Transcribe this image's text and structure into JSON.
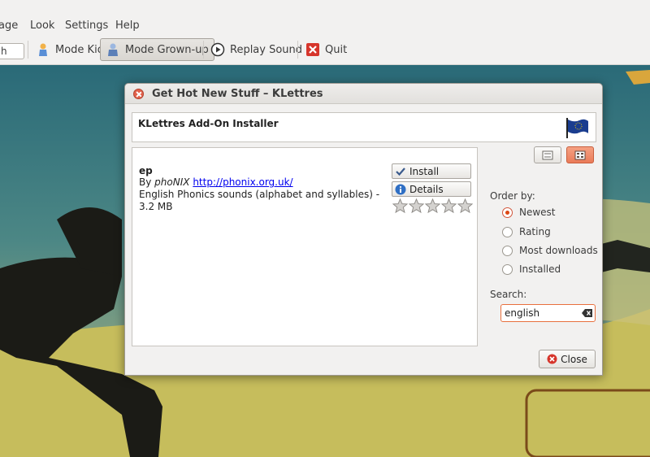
{
  "menubar": {
    "items": [
      "age",
      "Look",
      "Settings",
      "Help"
    ]
  },
  "toolbar": {
    "combo_value": "h",
    "mode_kid": "Mode Kid",
    "mode_grownup": "Mode Grown-up",
    "replay": "Replay Sound",
    "quit": "Quit"
  },
  "dialog": {
    "title": "Get Hot New Stuff – KLettres",
    "header": "KLettres Add-On Installer",
    "item": {
      "name": "ep",
      "by": "By",
      "author": "phoNIX",
      "url": "http://phonix.org.uk/",
      "description": "English Phonics sounds (alphabet and syllables) - 3.2 MB",
      "install_label": "Install",
      "details_label": "Details",
      "rating_stars": 0
    },
    "order_label": "Order by:",
    "order_options": [
      "Newest",
      "Rating",
      "Most downloads",
      "Installed"
    ],
    "order_selected": "Newest",
    "search_label": "Search:",
    "search_value": "english",
    "close_label": "Close"
  },
  "colors": {
    "accent": "#dd4814",
    "link": "#0000ee",
    "dialog_bg": "#f2f1f0"
  }
}
